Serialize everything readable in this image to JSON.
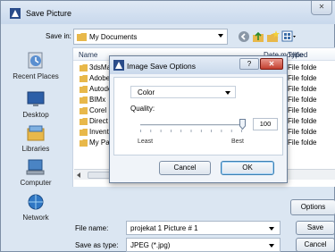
{
  "window": {
    "title": "Save Picture",
    "close_label": "✕"
  },
  "toolbar": {
    "savein_label": "Save in:",
    "savein_value": "My Documents"
  },
  "places": [
    {
      "label": "Recent Places",
      "icon": "recent-places-icon"
    },
    {
      "label": "Desktop",
      "icon": "desktop-icon"
    },
    {
      "label": "Libraries",
      "icon": "libraries-icon"
    },
    {
      "label": "Computer",
      "icon": "computer-icon"
    },
    {
      "label": "Network",
      "icon": "network-icon"
    }
  ],
  "list": {
    "columns": {
      "name": "Name",
      "date": "Date modified",
      "type": "Type"
    },
    "rows": [
      {
        "name": "3dsMax",
        "date": "PM",
        "type": "File folde"
      },
      {
        "name": "Adobe",
        "date": "M",
        "type": "File folde"
      },
      {
        "name": "Autodes",
        "date": "M",
        "type": "File folde"
      },
      {
        "name": "BIMx",
        "date": "M",
        "type": "File folde"
      },
      {
        "name": "Corel",
        "date": "M",
        "type": "File folde"
      },
      {
        "name": "Direct Co",
        "date": "PM",
        "type": "File folde"
      },
      {
        "name": "Inventor",
        "date": "PM",
        "type": "File folde"
      },
      {
        "name": "My Palet",
        "date": "M",
        "type": "File folde"
      }
    ]
  },
  "footer": {
    "options_label": "Options",
    "filename_label": "File name:",
    "filename_value": "projekat 1 Picture # 1",
    "savetype_label": "Save as type:",
    "savetype_value": "JPEG (*.jpg)",
    "save_label": "Save",
    "cancel_label": "Cancel"
  },
  "dialog": {
    "title": "Image Save Options",
    "help_label": "?",
    "close_label": "✕",
    "color_value": "Color",
    "quality_label": "Quality:",
    "quality_value": "100",
    "quality_fraction": 1.0,
    "least_label": "Least",
    "best_label": "Best",
    "cancel_label": "Cancel",
    "ok_label": "OK"
  },
  "colors": {
    "dialog_close": "#c33f2f",
    "folder": "#e8b84a",
    "accent_border": "#3c7fb1"
  }
}
